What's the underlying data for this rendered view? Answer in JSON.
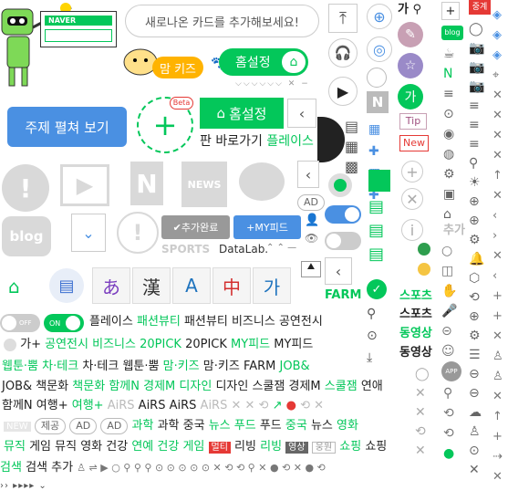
{
  "promo": {
    "card_text": "새로나온 카드를 추가해보세요!",
    "naver_label": "NAVER",
    "mamkids": "맘 키즈",
    "homeset": "홈설정",
    "topic_button": "주제 펼쳐 보기",
    "beta": "Beta",
    "homeset_big": "홈설정",
    "shortcut_text": "판 바로가기",
    "place": "플레이스"
  },
  "tiles": {
    "news": "NEWS",
    "blog": "blog",
    "ad": "AD",
    "sports": "SPORTS",
    "datalab": "DataLab.",
    "added": "추가완료",
    "myfeed": "MY피드"
  },
  "chars": [
    "あ",
    "漢",
    "A",
    "中",
    "가"
  ],
  "toggles": {
    "off": "OFF",
    "on": "ON"
  },
  "side": {
    "ga_top": "가",
    "blog": "blog",
    "tip": "Tip",
    "new": "New",
    "ga_circle": "가",
    "chuga": "추가",
    "app": "APP",
    "jungae": "중계",
    "farm": "FARM"
  },
  "right_labels": {
    "sports_g": "스포츠",
    "sports": "스포츠",
    "video_g": "동영상",
    "video": "동영상"
  },
  "rows": {
    "r1": [
      "플레이스",
      "패션뷰티",
      "패션뷰티",
      "비즈니스",
      "공연전시"
    ],
    "r2": [
      "가+",
      "공연전시",
      "비즈니스",
      "20PICK",
      "20PICK",
      "MY피드",
      "MY피드"
    ],
    "r3": [
      "웹툰·뿜",
      "차·테크",
      "차·테크",
      "웹툰·뿜",
      "맘·키즈",
      "맘·키즈",
      "FARM",
      "JOB&"
    ],
    "r4": [
      "JOB&",
      "책문화",
      "책문화",
      "함께N",
      "경제M",
      "디자인",
      "디자인",
      "스쿨잼",
      "경제M",
      "스쿨잼",
      "연애"
    ],
    "r5": [
      "함께N",
      "여행+",
      "여행+",
      "AiRS",
      "AiRS",
      "AiRS",
      "AiRS"
    ],
    "r6": [
      "NEW",
      "제공",
      "AD",
      "AD",
      "과학",
      "과학",
      "중국",
      "뉴스",
      "푸드",
      "푸드",
      "중국",
      "뉴스",
      "영화"
    ],
    "r7": [
      "뮤직",
      "게임",
      "뮤직",
      "영화",
      "건강",
      "연예",
      "건강",
      "게임",
      "멀티",
      "리빙",
      "리빙",
      "영상",
      "웅원",
      "쇼핑",
      "쇼핑"
    ],
    "r8": [
      "검색",
      "검색",
      "추가"
    ]
  },
  "colors": {
    "naver_green": "#03c75a",
    "blue": "#3b82f6",
    "light_blue": "#4a90e2",
    "gray": "#d9d9d9",
    "red": "#e53935"
  }
}
